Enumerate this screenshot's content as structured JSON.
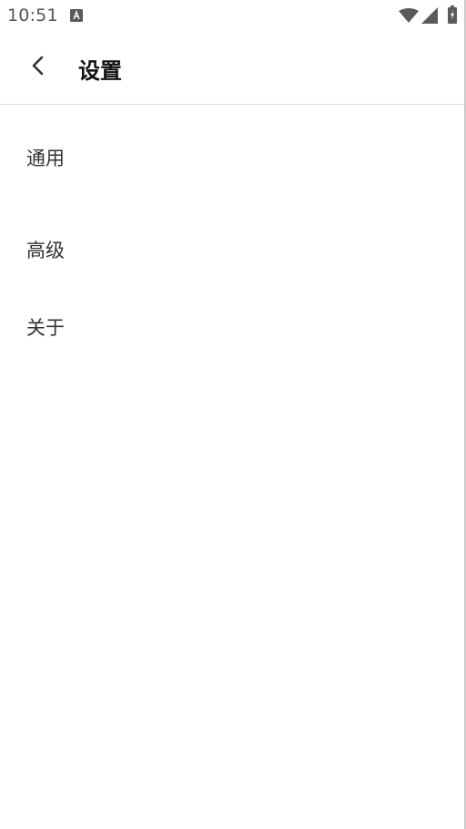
{
  "status_bar": {
    "time": "10:51",
    "icons": [
      "notification-a-icon",
      "wifi-icon",
      "cell-signal-icon",
      "battery-charging-icon"
    ]
  },
  "app_bar": {
    "back_icon": "chevron-left-icon",
    "title": "设置"
  },
  "settings": {
    "items": [
      {
        "label": "通用"
      },
      {
        "label": "高级"
      },
      {
        "label": "关于"
      }
    ]
  },
  "colors": {
    "background": "#ffffff",
    "divider": "#dcdcdc",
    "title_text": "#111111",
    "item_text": "#333333",
    "status_text": "#555555"
  }
}
